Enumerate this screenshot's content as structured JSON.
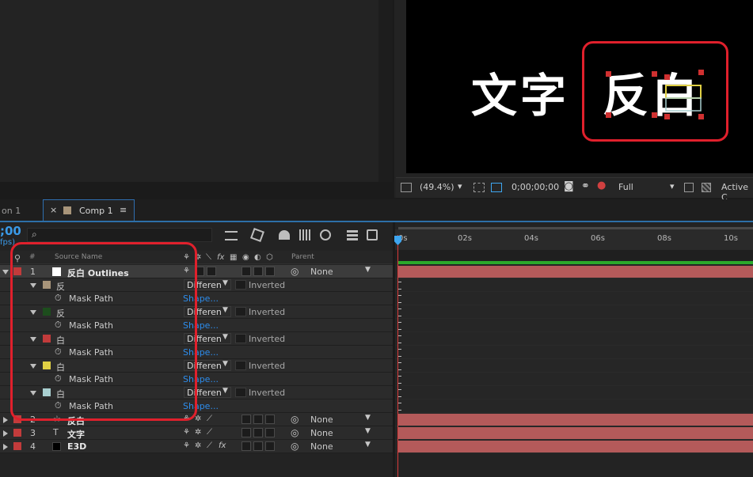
{
  "viewer": {
    "comp_text_1": "文字",
    "comp_text_2": "反白",
    "zoom": "(49.4%)",
    "timecode": "0;00;00;00",
    "resolution": "Full",
    "view": "Active C"
  },
  "tabs": {
    "prev_tab": "on 1",
    "comp_tab": "Comp 1",
    "close_glyph": "×",
    "menu_glyph": "≡"
  },
  "timeline": {
    "time_display": ";00",
    "fps_partial": "fps)",
    "ruler_labels": [
      "0s",
      "02s",
      "04s",
      "06s",
      "08s",
      "10s"
    ],
    "headers": {
      "num": "#",
      "source_name": "Source Name",
      "parent": "Parent",
      "fx": "fx"
    },
    "layers": [
      {
        "num": "1",
        "name": "反白 Outlines",
        "parent": "None",
        "label_color": "#c23b3b"
      },
      {
        "num": "2",
        "name": "反白",
        "parent": "None",
        "label_color": "#c23b3b"
      },
      {
        "num": "3",
        "name": "文字",
        "parent": "None",
        "label_color": "#c23b3b"
      },
      {
        "num": "4",
        "name": "E3D",
        "parent": "None",
        "label_color": "#c23b3b"
      }
    ],
    "masks": [
      {
        "name": "反",
        "color": "#a8957a",
        "mode": "Differen",
        "inverted": "Inverted",
        "path_label": "Mask Path",
        "path_value": "Shape..."
      },
      {
        "name": "反",
        "color": "#1d4d1d",
        "mode": "Differen",
        "inverted": "Inverted",
        "path_label": "Mask Path",
        "path_value": "Shape..."
      },
      {
        "name": "白",
        "color": "#c23b3b",
        "mode": "Differen",
        "inverted": "Inverted",
        "path_label": "Mask Path",
        "path_value": "Shape..."
      },
      {
        "name": "白",
        "color": "#e0d044",
        "mode": "Differen",
        "inverted": "Inverted",
        "path_label": "Mask Path",
        "path_value": "Shape..."
      },
      {
        "name": "白",
        "color": "#a9cfd0",
        "mode": "Differen",
        "inverted": "Inverted",
        "path_label": "Mask Path",
        "path_value": "Shape..."
      }
    ]
  },
  "colors": {
    "accent": "#2d8ceb",
    "highlight": "#e0202c",
    "bar": "#b45a5a",
    "green": "#2ba82b"
  }
}
